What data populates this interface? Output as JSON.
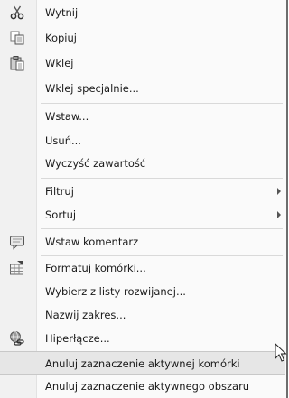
{
  "menu": {
    "items": [
      {
        "label": "Wytnij",
        "icon": "scissors-icon"
      },
      {
        "label": "Kopiuj",
        "icon": "copy-icon"
      },
      {
        "label": "Wklej",
        "icon": "paste-icon"
      },
      {
        "label": "Wklej specjalnie..."
      },
      {
        "label": "Wstaw..."
      },
      {
        "label": "Usuń..."
      },
      {
        "label": "Wyczyść zawartość"
      },
      {
        "label": "Filtruj",
        "submenu": true
      },
      {
        "label": "Sortuj",
        "submenu": true
      },
      {
        "label": "Wstaw komentarz",
        "icon": "comment-icon"
      },
      {
        "label": "Formatuj komórki...",
        "icon": "format-cells-icon"
      },
      {
        "label": "Wybierz z listy rozwijanej..."
      },
      {
        "label": "Nazwij zakres..."
      },
      {
        "label": "Hiperłącze...",
        "icon": "hyperlink-icon"
      },
      {
        "label": "Anuluj zaznaczenie aktywnej komórki"
      },
      {
        "label": "Anuluj zaznaczenie aktywnego obszaru"
      }
    ]
  }
}
